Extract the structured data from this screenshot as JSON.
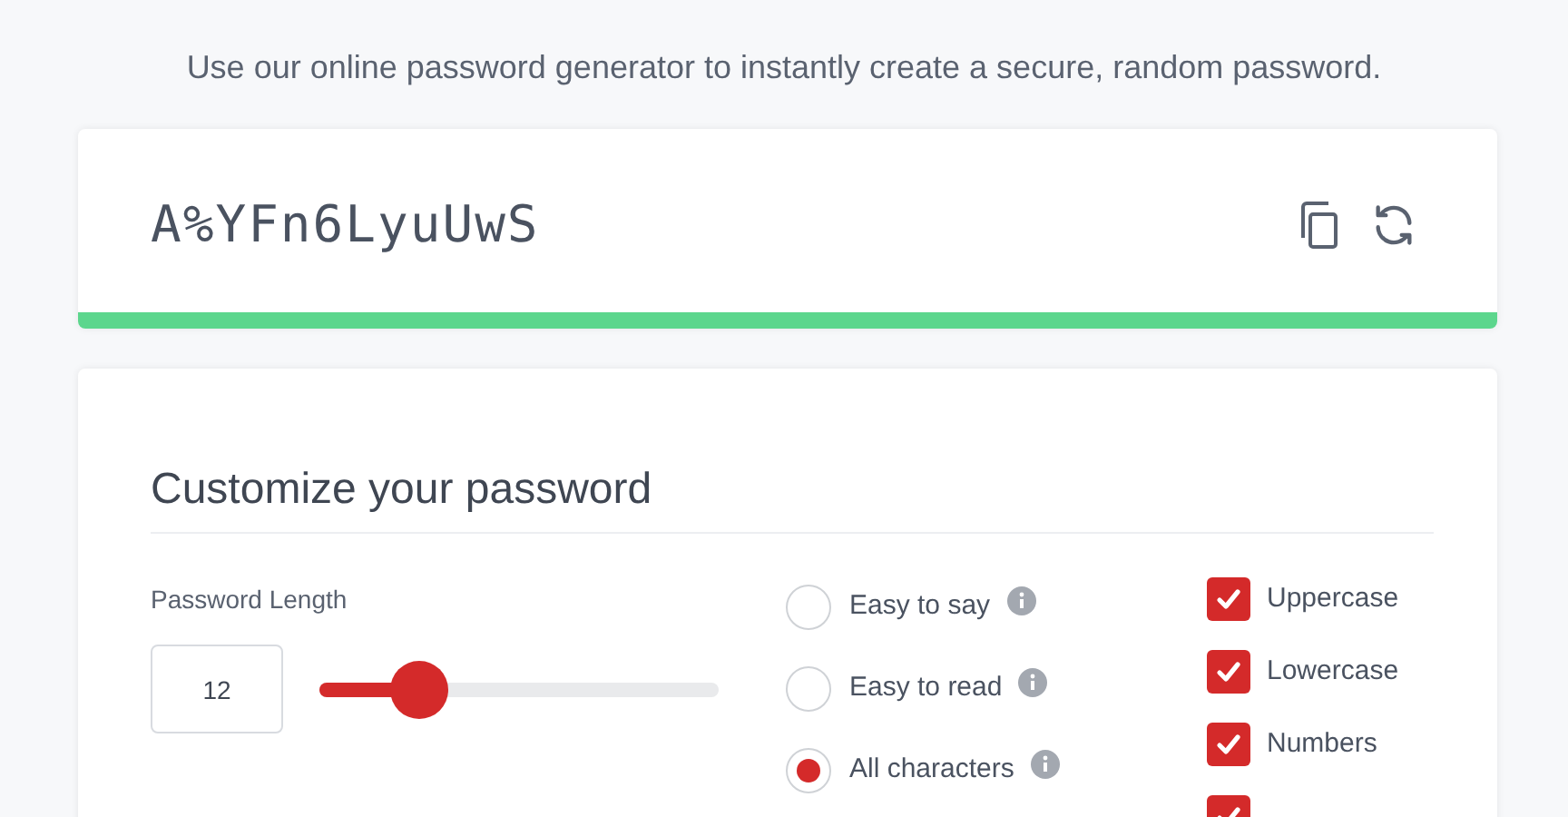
{
  "subtitle": "Use our online password generator to instantly create a secure, random password.",
  "password": {
    "value": "A%YFn6LyuUwS"
  },
  "customize": {
    "title": "Customize your password",
    "length": {
      "label": "Password Length",
      "value": "12",
      "level": 0.25
    },
    "modes": [
      {
        "label": "Easy to say",
        "selected": false
      },
      {
        "label": "Easy to read",
        "selected": false
      },
      {
        "label": "All characters",
        "selected": true
      }
    ],
    "options": [
      {
        "label": "Uppercase",
        "checked": true
      },
      {
        "label": "Lowercase",
        "checked": true
      },
      {
        "label": "Numbers",
        "checked": true
      },
      {
        "checked": true
      }
    ]
  }
}
